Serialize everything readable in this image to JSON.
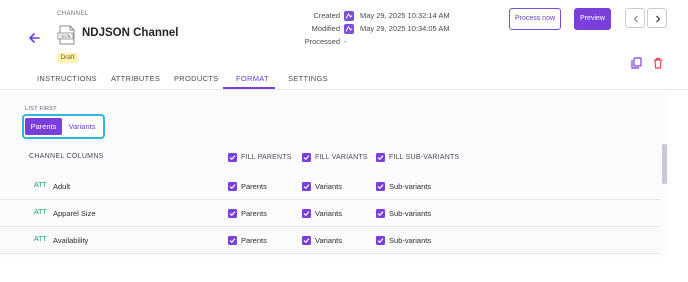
{
  "header": {
    "channel_kind": "CHANNEL",
    "channel_title": "NDJSON Channel",
    "status_badge": "Draft",
    "file_icon_text": "JSON",
    "meta": {
      "created_label": "Created",
      "created_value": "May 29, 2025 10:32:14 AM",
      "modified_label": "Modified",
      "modified_value": "May 29, 2025 10:34:05 AM",
      "processed_label": "Processed",
      "processed_value": "-"
    },
    "process_now_label": "Process now",
    "preview_label": "Preview"
  },
  "tabs": [
    {
      "label": "INSTRUCTIONS",
      "active": false
    },
    {
      "label": "ATTRIBUTES",
      "active": false
    },
    {
      "label": "PRODUCTS",
      "active": false
    },
    {
      "label": "FORMAT",
      "active": true
    },
    {
      "label": "SETTINGS",
      "active": false
    }
  ],
  "format": {
    "list_first_label": "LIST FIRST",
    "toggle_options": [
      "Parents",
      "Variants"
    ],
    "toggle_selected": "Parents"
  },
  "table": {
    "column_title": "CHANNEL COLUMNS",
    "fill_headers": [
      "FILL PARENTS",
      "FILL VARIANTS",
      "FILL SUB-VARIANTS"
    ],
    "rows": [
      {
        "type": "ATT",
        "name": "Adult",
        "cells": [
          "Parents",
          "Variants",
          "Sub-variants"
        ]
      },
      {
        "type": "ATT",
        "name": "Apparel Size",
        "cells": [
          "Parents",
          "Variants",
          "Sub-variants"
        ]
      },
      {
        "type": "ATT",
        "name": "Availability",
        "cells": [
          "Parents",
          "Variants",
          "Sub-variants"
        ]
      }
    ]
  },
  "colors": {
    "accent": "#7a3fd9",
    "focus_ring": "#32b7d9",
    "badge_bg": "#fdf1b4",
    "att_green": "#1f9e6a",
    "danger": "#e04b4b"
  },
  "icons": [
    "back-arrow-icon",
    "json-file-icon",
    "avatar-icon",
    "chevron-left-icon",
    "chevron-right-icon",
    "copy-icon",
    "trash-icon",
    "checkbox-checked-icon"
  ]
}
